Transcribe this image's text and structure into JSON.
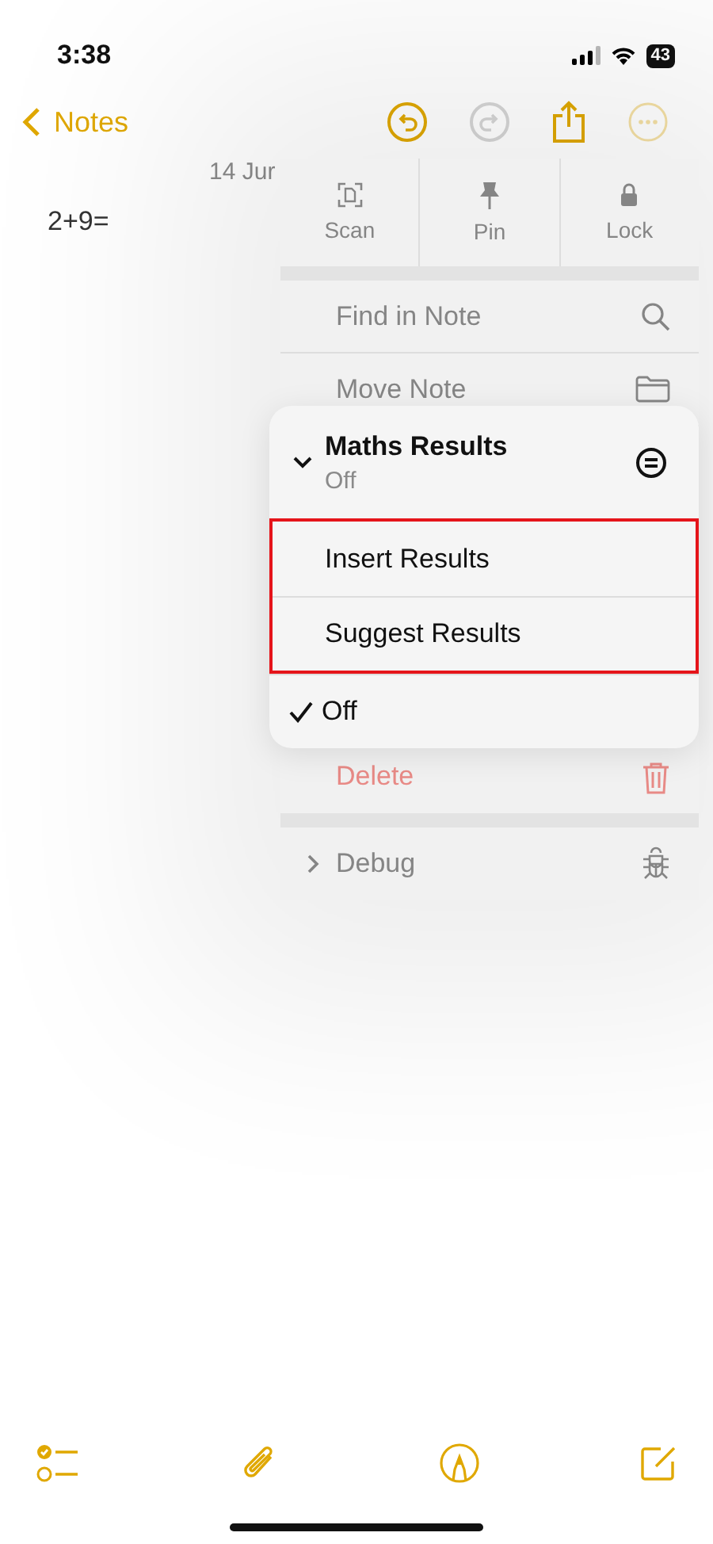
{
  "status_bar": {
    "time": "3:38",
    "battery": "43"
  },
  "nav": {
    "back": "Notes",
    "buttons": [
      {
        "kind": "undo",
        "disabled": false
      },
      {
        "kind": "redo",
        "disabled": true
      },
      {
        "kind": "share",
        "disabled": false
      },
      {
        "kind": "more",
        "disabled": true
      }
    ]
  },
  "note": {
    "date": "14 Jur",
    "text": "2+9="
  },
  "menu": {
    "actions": [
      {
        "kind": "scan",
        "label": "Scan"
      },
      {
        "kind": "pin",
        "label": "Pin"
      },
      {
        "kind": "lock",
        "label": "Lock"
      }
    ],
    "items": [
      {
        "kind": "search",
        "label": "Find in Note"
      },
      {
        "kind": "folder",
        "label": "Move Note"
      }
    ],
    "delete": {
      "label": "Delete"
    },
    "debug": {
      "label": "Debug",
      "expanded": false
    }
  },
  "submenu": {
    "title": "Maths Results",
    "value": "Off",
    "expanded": true,
    "options": [
      {
        "label": "Insert Results",
        "selected": false,
        "highlighted": true
      },
      {
        "label": "Suggest Results",
        "selected": false,
        "highlighted": true
      },
      {
        "label": "Off",
        "selected": true,
        "highlighted": false
      }
    ]
  }
}
